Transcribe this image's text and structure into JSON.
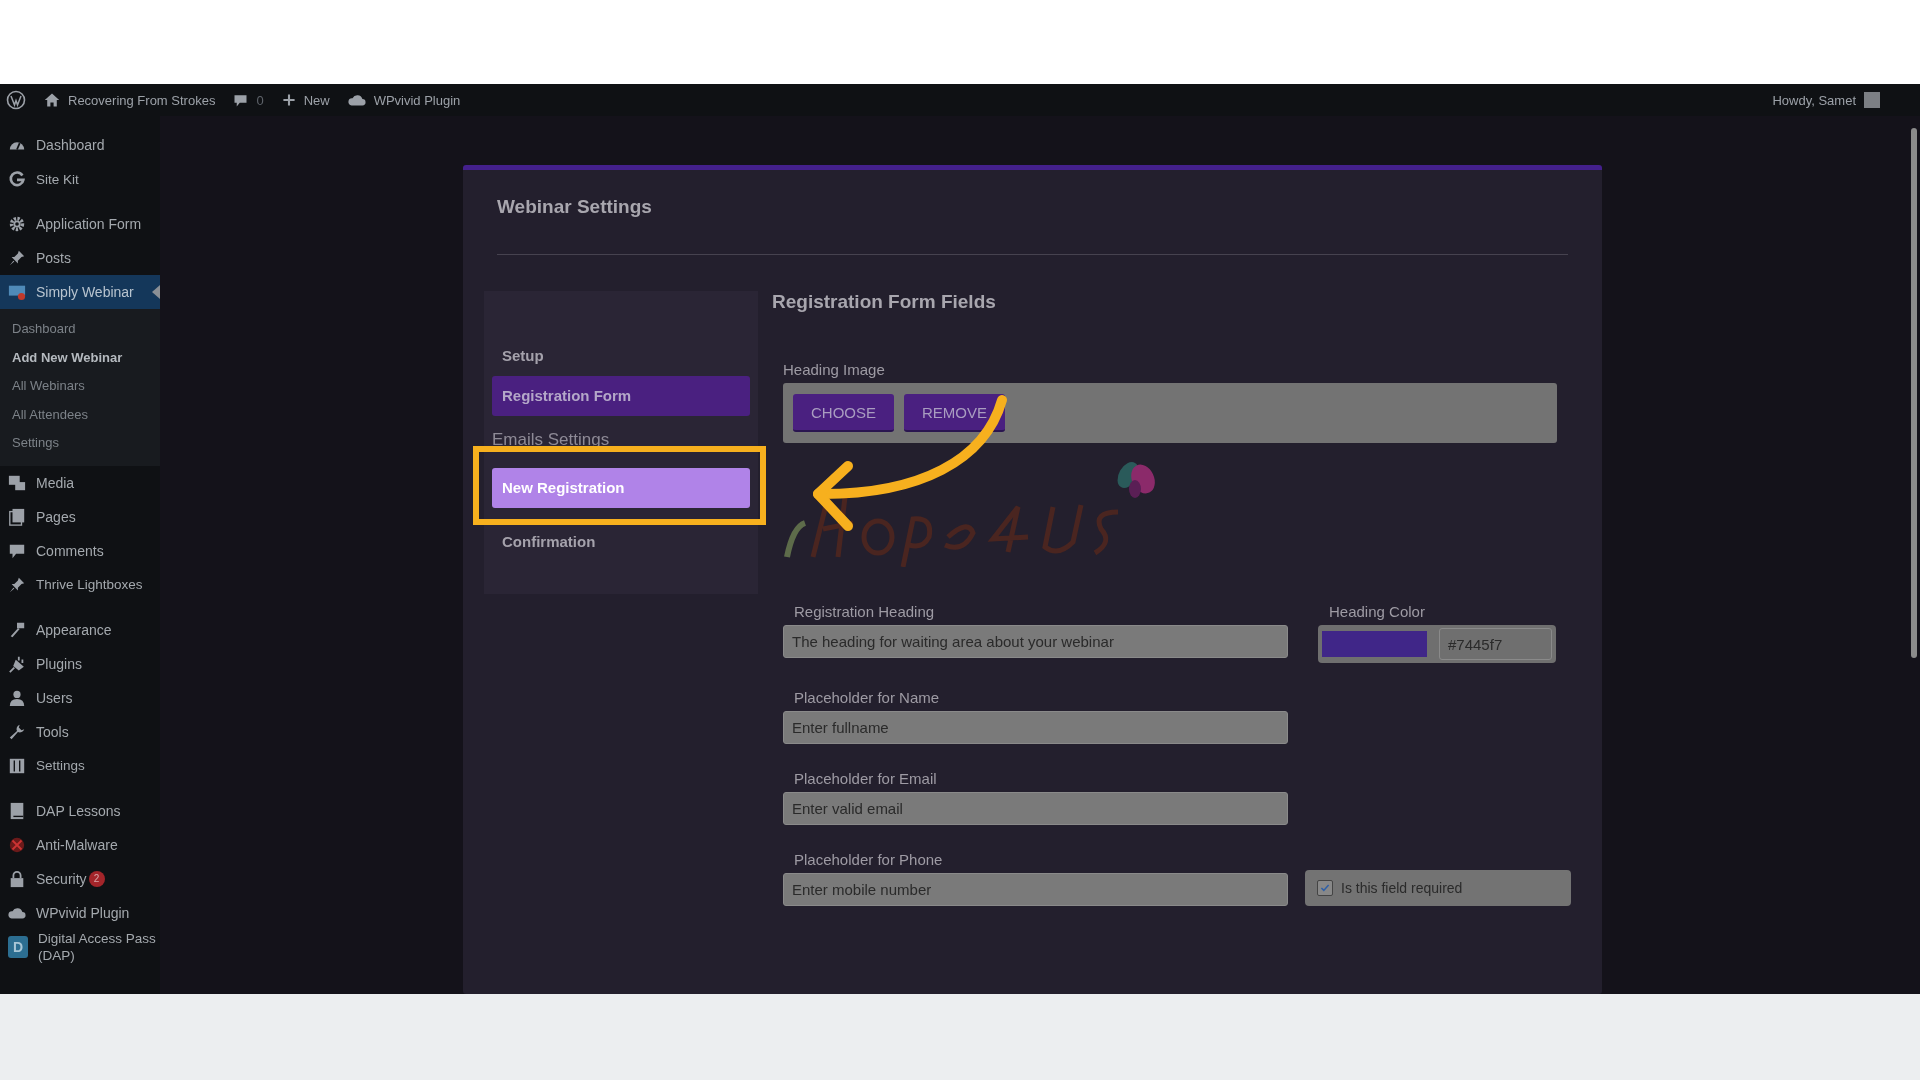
{
  "admin_bar": {
    "site": "Recovering From Strokes",
    "comments": "0",
    "new": "New",
    "plugin": "WPvivid Plugin",
    "greeting": "Howdy, Samet"
  },
  "sidebar": {
    "groups": [
      [
        {
          "label": "Dashboard",
          "selected": false
        },
        {
          "label": "Site Kit",
          "selected": false
        }
      ],
      [
        {
          "label": "Application Form",
          "selected": false
        },
        {
          "label": "Posts",
          "selected": false
        },
        {
          "label": "Simply Webinar",
          "selected": true,
          "children": [
            {
              "label": "Dashboard",
              "selected": false
            },
            {
              "label": "Add New Webinar",
              "selected": true
            },
            {
              "label": "All Webinars",
              "selected": false
            },
            {
              "label": "All Attendees",
              "selected": false
            },
            {
              "label": "Settings",
              "selected": false
            }
          ]
        },
        {
          "label": "Media",
          "selected": false
        },
        {
          "label": "Pages",
          "selected": false
        },
        {
          "label": "Comments",
          "selected": false
        },
        {
          "label": "Thrive Lightboxes",
          "selected": false
        }
      ],
      [
        {
          "label": "Appearance",
          "selected": false
        },
        {
          "label": "Plugins",
          "selected": false
        },
        {
          "label": "Users",
          "selected": false
        },
        {
          "label": "Tools",
          "selected": false
        },
        {
          "label": "Settings",
          "selected": false
        }
      ],
      [
        {
          "label": "DAP Lessons",
          "selected": false
        },
        {
          "label": "Anti-Malware",
          "selected": false
        },
        {
          "label": "Security",
          "selected": false,
          "badge": "2"
        },
        {
          "label": "WPvivid Plugin",
          "selected": false
        },
        {
          "label": "Digital Access Pass (DAP)",
          "selected": false,
          "tile": "D"
        }
      ]
    ]
  },
  "panel": {
    "title": "Webinar Settings",
    "nav": [
      {
        "kind": "item",
        "label": "Setup",
        "selected": false,
        "highlighted": false
      },
      {
        "kind": "item",
        "label": "Registration Form",
        "selected": true,
        "highlighted": false
      },
      {
        "kind": "heading",
        "label": "Emails Settings"
      },
      {
        "kind": "item",
        "label": "New Registration",
        "selected": false,
        "highlighted": true
      },
      {
        "kind": "item",
        "label": "Confirmation",
        "selected": false,
        "highlighted": false
      }
    ],
    "section_title": "Registration Form Fields",
    "heading_image": {
      "label": "Heading Image",
      "buttons": [
        "CHOOSE",
        "REMOVE"
      ]
    },
    "registration_heading": {
      "label": "Registration Heading",
      "placeholder": "The heading for waiting area about your webinar"
    },
    "heading_color": {
      "label": "Heading Color",
      "value": "#7445f7"
    },
    "fields": [
      {
        "label": "Placeholder for Name",
        "value": "Enter fullname"
      },
      {
        "label": "Placeholder for Email",
        "value": "Enter valid email"
      },
      {
        "label": "Placeholder for Phone",
        "value": "Enter mobile number",
        "required": {
          "label": "Is this field required",
          "checked": true
        }
      }
    ]
  }
}
